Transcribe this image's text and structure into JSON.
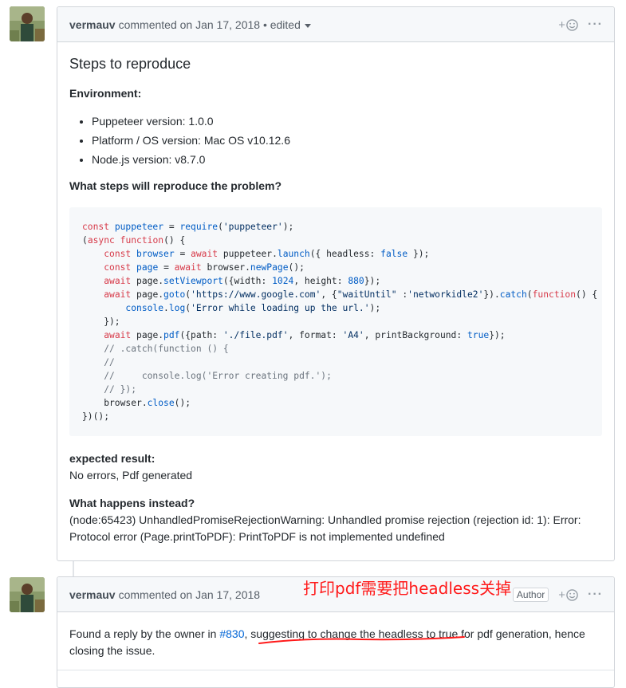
{
  "comments": [
    {
      "author": "vermauv",
      "meta": "commented on Jan 17, 2018 • edited",
      "title": "Steps to reproduce",
      "environment_label": "Environment:",
      "environment_items": [
        "Puppeteer version: 1.0.0",
        "Platform / OS version: Mac OS v10.12.6",
        "Node.js version: v8.7.0"
      ],
      "steps_label": "What steps will reproduce the problem?",
      "expected_label": "expected result:",
      "expected_text": "No errors, Pdf generated",
      "instead_label": "What happens instead?",
      "instead_text": "(node:65423) UnhandledPromiseRejectionWarning: Unhandled promise rejection (rejection id: 1): Error: Protocol error (Page.printToPDF): PrintToPDF is not implemented undefined"
    },
    {
      "author": "vermauv",
      "meta": "commented on Jan 17, 2018",
      "badge": "Author",
      "reply_prefix": "Found a reply by the owner in ",
      "reply_link": "#830",
      "reply_suffix": ", suggesting to change the headless to true for pdf generation, hence closing the issue."
    }
  ],
  "annotation": "打印pdf需要把headless关掉",
  "reaction_plus": "+",
  "more_dots": "···",
  "colors": {
    "annotation": "#ff1a1a",
    "link": "#0366d6",
    "keyword": "#d73a49"
  }
}
